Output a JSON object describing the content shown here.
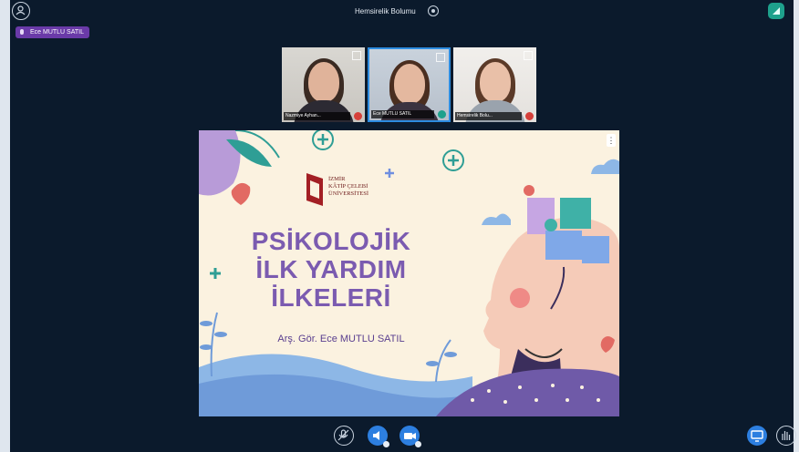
{
  "meeting": {
    "title": "Hemsirelik Bolumu"
  },
  "talker": {
    "name": "Ece MUTLU SATIL"
  },
  "participants": [
    {
      "name": "Nazmiye Ayhan..."
    },
    {
      "name": "Ece MUTLU SATIL"
    },
    {
      "name": "Hemsirelik Bolu..."
    }
  ],
  "slide": {
    "university_lines": [
      "İZMİR",
      "KÂTİP ÇELEBİ",
      "ÜNİVERSİTESİ"
    ],
    "title_lines": [
      "PSİKOLOJİK",
      "İLK YARDIM",
      "İLKELERİ"
    ],
    "author": "Arş. Gör. Ece MUTLU SATIL",
    "options_label": "⋮"
  },
  "colors": {
    "background": "#0b1a2c",
    "accent_blue": "#2d7fe0",
    "talker_purple": "#6a3aa8",
    "connection_green": "#1ea18c",
    "mic_muted": "#d6403a"
  }
}
